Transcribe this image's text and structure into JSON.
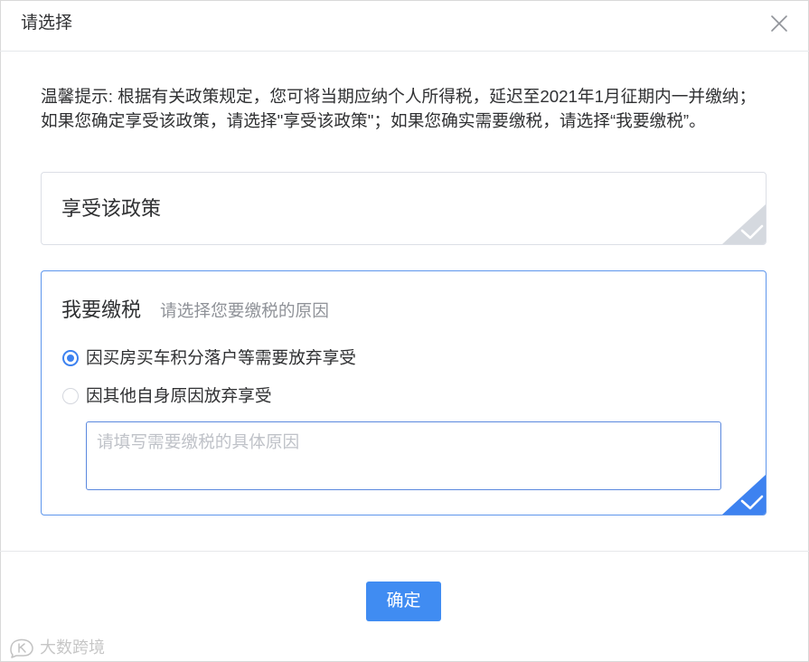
{
  "dialog": {
    "title": "请选择",
    "close_icon": "close-icon"
  },
  "notice": {
    "lines": [
      "温馨提示: 根据有关政策规定，您可将当期应纳个人所得税，延迟至2021年1月征期内一并缴纳；",
      "如果您确定享受该政策，请选择\"享受该政策\"；如果您确实需要缴税，请选择“我要缴税”。"
    ]
  },
  "options": [
    {
      "label": "享受该政策",
      "selected": false,
      "corner_icon": "checkmark-icon"
    },
    {
      "label": "我要缴税",
      "hint": "请选择您要缴税的原因",
      "selected": true,
      "corner_icon": "checkmark-icon",
      "reasons": [
        {
          "label": "因买房买车积分落户等需要放弃享受",
          "checked": true
        },
        {
          "label": "因其他自身原因放弃享受",
          "checked": false
        }
      ],
      "reason_input": {
        "value": "",
        "placeholder": "请填写需要缴税的具体原因"
      }
    }
  ],
  "footer": {
    "confirm_label": "确定"
  },
  "watermark": {
    "text": "大数跨境",
    "logo_icon": "brand-logo-icon"
  },
  "colors": {
    "accent": "#3d82f0",
    "accent_border": "#5e96ec",
    "button": "#408cf2",
    "muted_border": "#dcdfe6",
    "muted_corner": "#d5d9df",
    "input_border": "#5a88de",
    "text": "#303133",
    "placeholder": "#bfc2c8",
    "hint": "#909399"
  }
}
